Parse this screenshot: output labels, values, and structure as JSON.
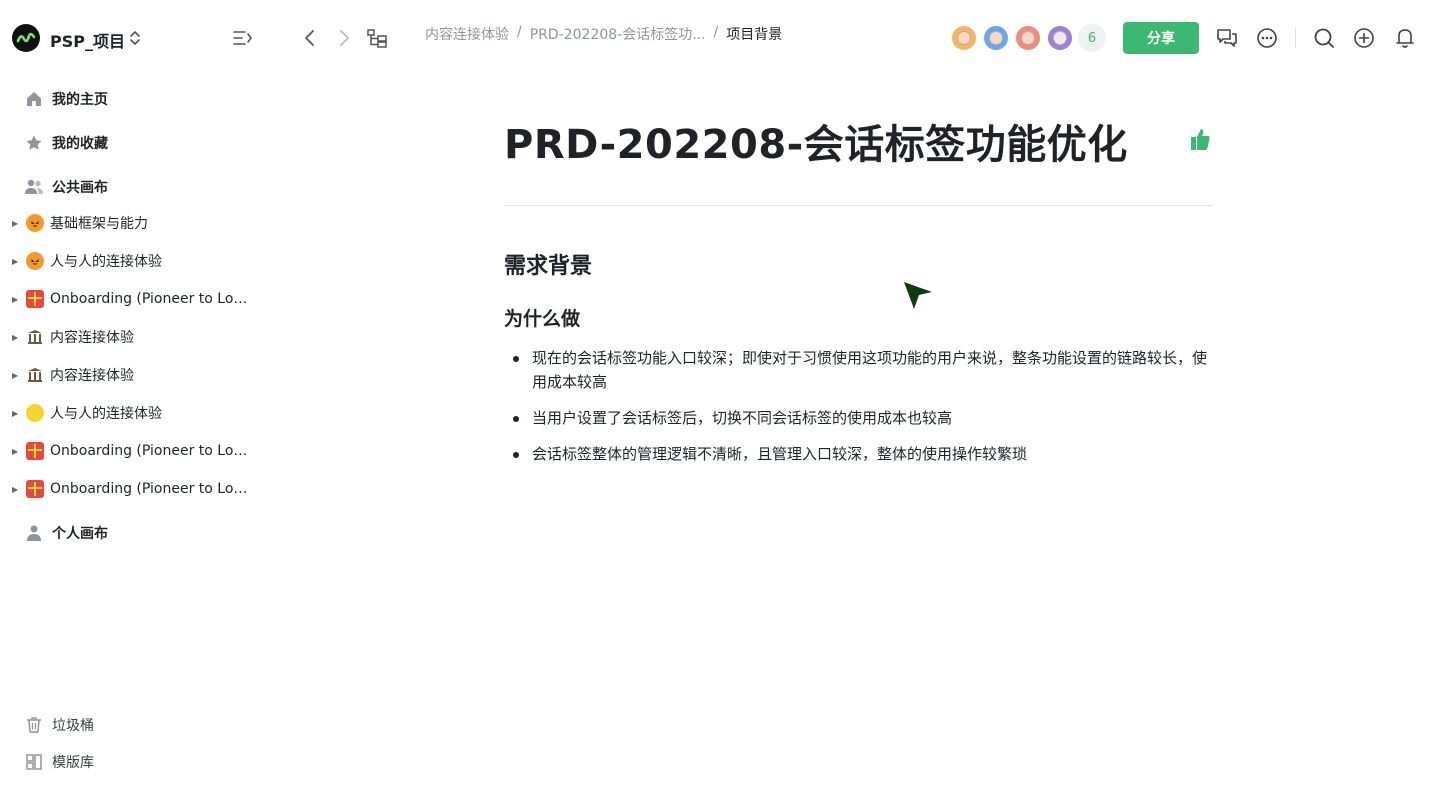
{
  "workspace": {
    "name": "PSP_项目"
  },
  "breadcrumb": {
    "items": [
      "内容连接体验",
      "PRD-202208-会话标签功...",
      "项目背景"
    ],
    "separator": "/"
  },
  "collaborators": {
    "avatars": [
      {
        "name": "avatar-1",
        "color": "#f5b567"
      },
      {
        "name": "avatar-2",
        "color": "#6aa6f0"
      },
      {
        "name": "avatar-3",
        "color": "#f08a7e"
      },
      {
        "name": "avatar-4",
        "color": "#9b7fd9"
      }
    ],
    "more_count": "6"
  },
  "toolbar": {
    "share_label": "分享"
  },
  "sidebar": {
    "top_items": [
      {
        "label": "我的主页",
        "icon": "home-icon"
      },
      {
        "label": "我的收藏",
        "icon": "star-icon"
      },
      {
        "label": "公共画布",
        "icon": "people-icon"
      }
    ],
    "tree": [
      {
        "label": "基础框架与能力",
        "icon": "pumpkin-icon"
      },
      {
        "label": "人与人的连接体验",
        "icon": "pumpkin-icon"
      },
      {
        "label": "Onboarding (Pioneer to Loca...",
        "icon": "gift-icon"
      },
      {
        "label": "内容连接体验",
        "icon": "temple-icon"
      },
      {
        "label": "内容连接体验",
        "icon": "temple-icon"
      },
      {
        "label": "人与人的连接体验",
        "icon": "moon-icon"
      },
      {
        "label": "Onboarding (Pioneer to Loca...",
        "icon": "gift-icon"
      },
      {
        "label": "Onboarding (Pioneer to Loca...",
        "icon": "gift-icon"
      }
    ],
    "personal": {
      "label": "个人画布",
      "icon": "person-icon"
    },
    "bottom_items": [
      {
        "label": "垃圾桶",
        "icon": "trash-icon"
      },
      {
        "label": "模版库",
        "icon": "template-icon"
      }
    ]
  },
  "document": {
    "title": "PRD-202208-会话标签功能优化",
    "heading": "需求背景",
    "subheading": "为什么做",
    "bullets": [
      "现在的会话标签功能入口较深；即使对于习惯使用这项功能的用户来说，整条功能设置的链路较长，使用成本较高",
      "当用户设置了会话标签后，切换不同会话标签的使用成本也较高",
      "会话标签整体的管理逻辑不清晰，且管理入口较深，整体的使用操作较繁琐"
    ]
  },
  "colors": {
    "accent": "#3db873",
    "text": "#1f2329",
    "muted": "#8f959e"
  }
}
